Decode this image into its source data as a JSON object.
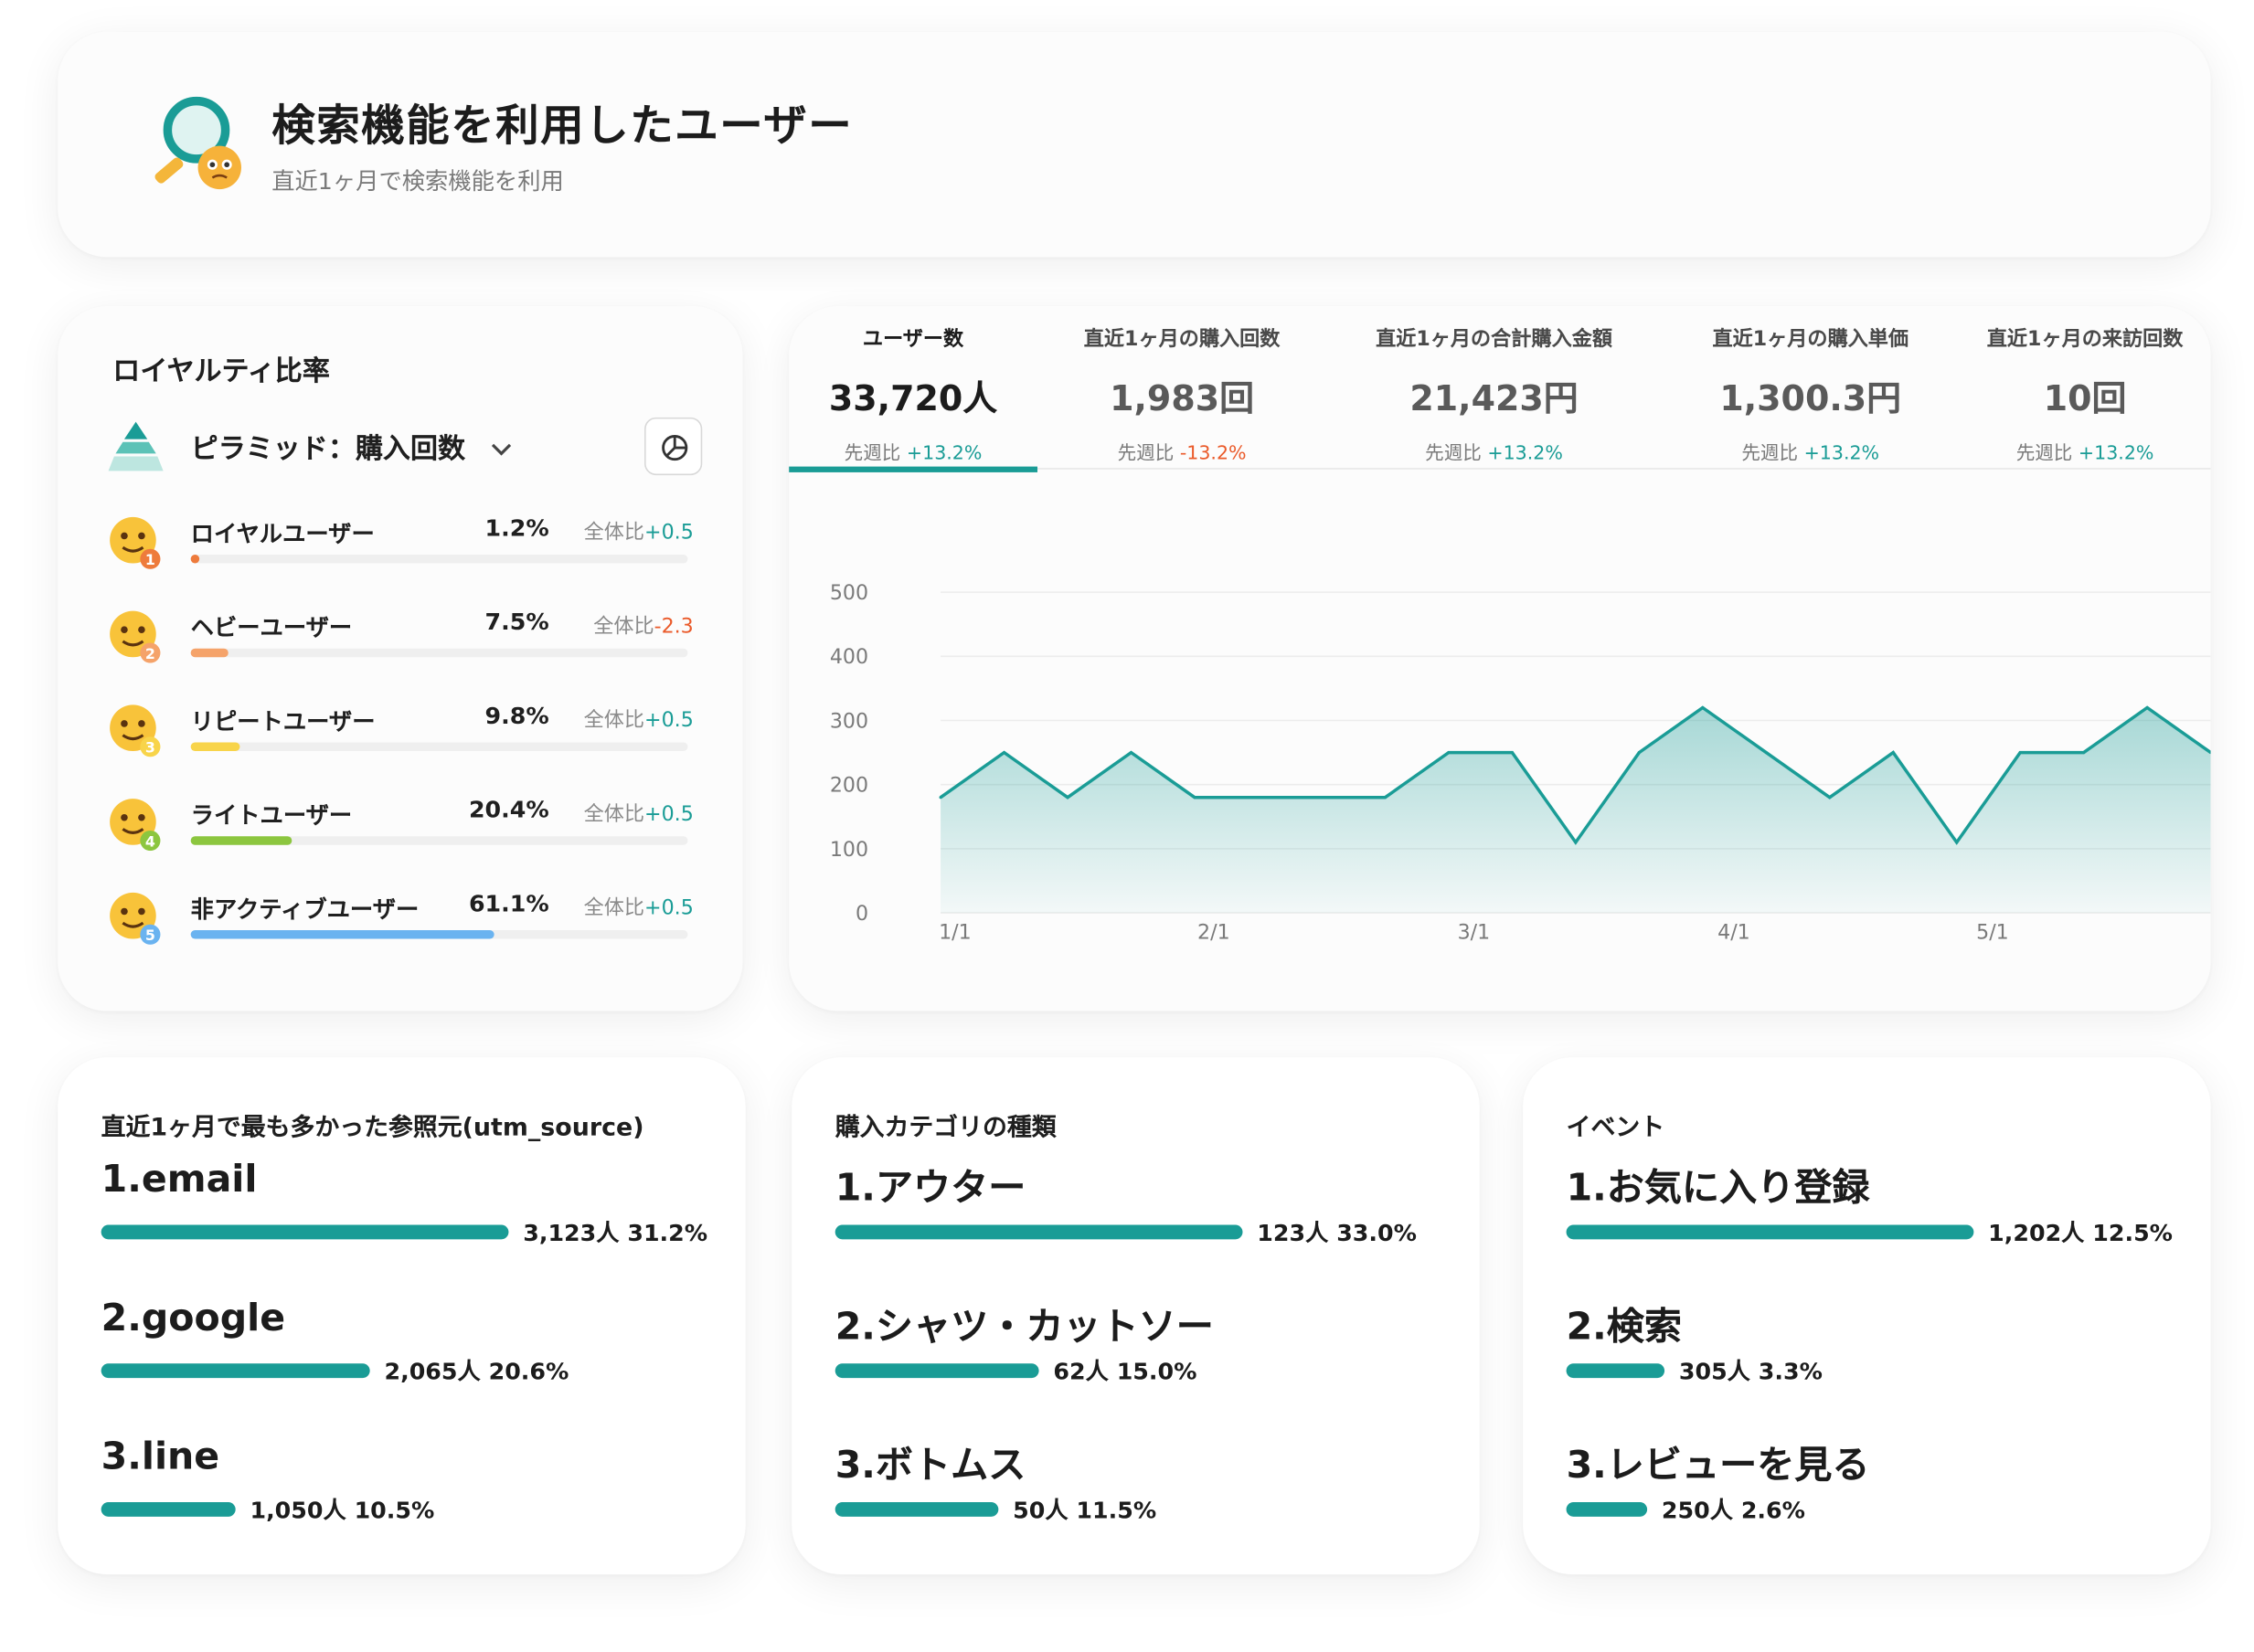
{
  "header": {
    "title": "検索機能を利用したユーザー",
    "subtitle": "直近1ヶ月で検索機能を利用"
  },
  "loyalty": {
    "title": "ロイヤルティ比率",
    "selector": "ピラミッド：購入回数",
    "rows": [
      {
        "name": "ロイヤルユーザー",
        "pct": "1.2%",
        "delta_prefix": "全体比",
        "delta": "+0.5",
        "fill": 0.012,
        "color": "#ee7b3c"
      },
      {
        "name": "ヘビーユーザー",
        "pct": "7.5%",
        "delta_prefix": "全体比",
        "delta": "-2.3",
        "fill": 0.075,
        "color": "#f5a36a"
      },
      {
        "name": "リピートユーザー",
        "pct": "9.8%",
        "delta_prefix": "全体比",
        "delta": "+0.5",
        "fill": 0.098,
        "color": "#f8d44a"
      },
      {
        "name": "ライトユーザー",
        "pct": "20.4%",
        "delta_prefix": "全体比",
        "delta": "+0.5",
        "fill": 0.204,
        "color": "#8cc63f"
      },
      {
        "name": "非アクティブユーザー",
        "pct": "61.1%",
        "delta_prefix": "全体比",
        "delta": "+0.5",
        "fill": 0.611,
        "color": "#6ab3f0"
      }
    ]
  },
  "metrics": [
    {
      "label": "ユーザー数",
      "value": "33,720人",
      "delta_prefix": "先週比",
      "delta": "+13.2%"
    },
    {
      "label": "直近1ヶ月の購入回数",
      "value": "1,983回",
      "delta_prefix": "先週比",
      "delta": "-13.2%"
    },
    {
      "label": "直近1ヶ月の合計購入金額",
      "value": "21,423円",
      "delta_prefix": "先週比",
      "delta": "+13.2%"
    },
    {
      "label": "直近1ヶ月の購入単価",
      "value": "1,300.3円",
      "delta_prefix": "先週比",
      "delta": "+13.2%"
    },
    {
      "label": "直近1ヶ月の来訪回数",
      "value": "10回",
      "delta_prefix": "先週比",
      "delta": "+13.2%"
    }
  ],
  "chart_data": {
    "type": "area",
    "title": "",
    "xlabel": "",
    "ylabel": "",
    "ylim": [
      0,
      500
    ],
    "yticks": [
      "0",
      "100",
      "200",
      "300",
      "400",
      "500"
    ],
    "xticks": [
      "1/1",
      "2/1",
      "3/1",
      "4/1",
      "5/1"
    ],
    "series": [
      {
        "values": [
          180,
          250,
          180,
          250,
          180,
          180,
          180,
          180,
          250,
          250,
          110,
          250,
          320,
          250,
          180,
          250,
          110,
          250,
          250,
          320,
          250
        ]
      }
    ],
    "color": "#1a9c96"
  },
  "ranks": [
    {
      "title": "直近1ヶ月で最も多かった参照元(utm_source)",
      "items": [
        {
          "name": "1.email",
          "value": "3,123人 31.2%",
          "ratio": 1.0
        },
        {
          "name": "2.google",
          "value": "2,065人 20.6%",
          "ratio": 0.66
        },
        {
          "name": "3.line",
          "value": "1,050人 10.5%",
          "ratio": 0.33
        }
      ]
    },
    {
      "title": "購入カテゴリの種類",
      "items": [
        {
          "name": "1.アウター",
          "value": "123人 33.0%",
          "ratio": 1.0
        },
        {
          "name": "2.シャツ・カットソー",
          "value": "62人 15.0%",
          "ratio": 0.5
        },
        {
          "name": "3.ボトムス",
          "value": "50人 11.5%",
          "ratio": 0.4
        }
      ]
    },
    {
      "title": "イベント",
      "items": [
        {
          "name": "1.お気に入り登録",
          "value": "1,202人 12.5%",
          "ratio": 1.0
        },
        {
          "name": "2.検索",
          "value": "305人 3.3%",
          "ratio": 0.24
        },
        {
          "name": "3.レビューを見る",
          "value": "250人 2.6%",
          "ratio": 0.2
        }
      ]
    }
  ]
}
